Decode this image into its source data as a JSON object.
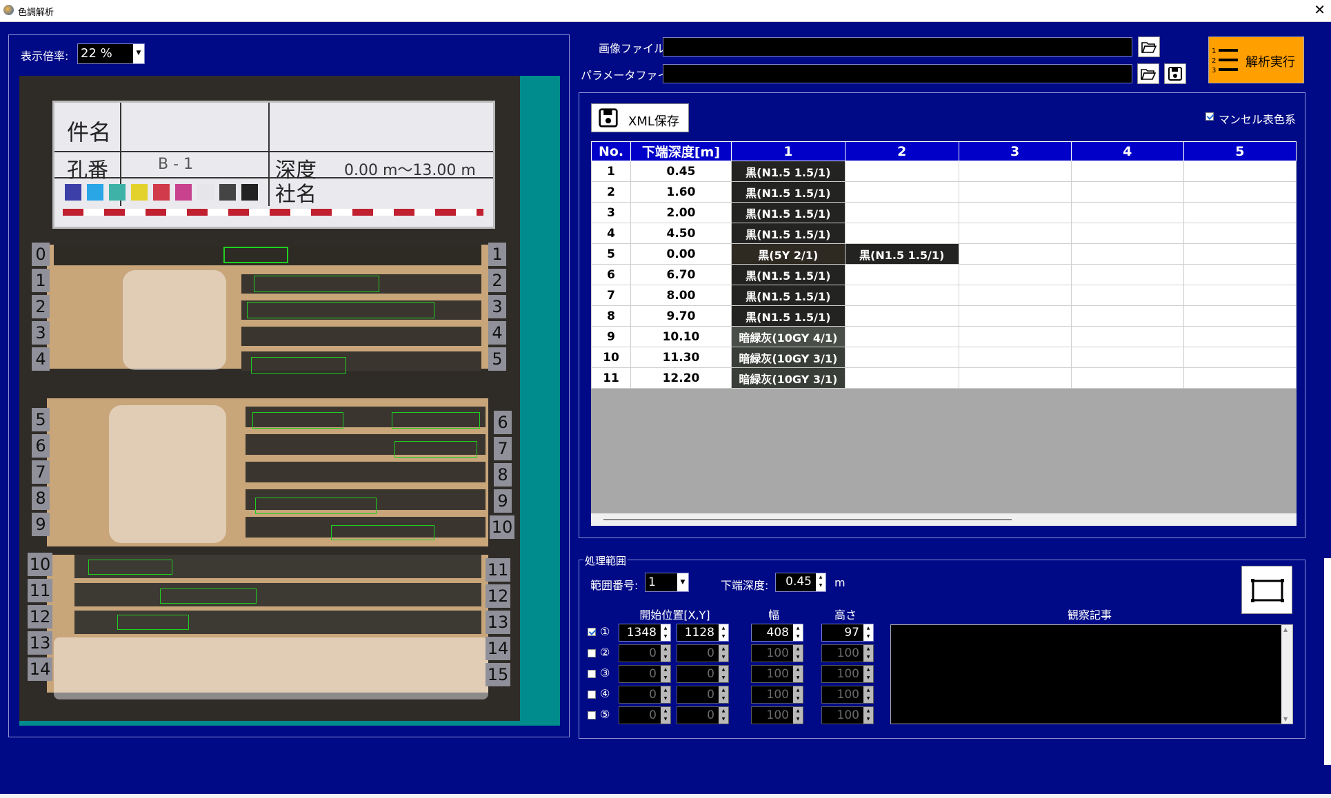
{
  "window": {
    "title": "色調解析",
    "close": "✕"
  },
  "zoom": {
    "label": "表示倍率:",
    "value": "22 %"
  },
  "files": {
    "image_label": "画像ファイル:",
    "param_label": "パラメータファイル:"
  },
  "run": {
    "label": "解析実行",
    "icon": "numbered-list-icon"
  },
  "xml": {
    "label": "XML保存"
  },
  "munsell": {
    "label": "マンセル表色系",
    "checked": true
  },
  "photo": {
    "board_name": "件名",
    "board_hole": "孔番",
    "board_hole_value": "B - 1",
    "board_depth": "深度",
    "board_depth_value": "0.00 m〜13.00 m",
    "board_company": "社名",
    "tags_left": [
      "0",
      "1",
      "2",
      "3",
      "4",
      "5",
      "6",
      "7",
      "8",
      "9",
      "10",
      "11",
      "12",
      "13",
      "14"
    ],
    "tags_right": [
      "1",
      "2",
      "3",
      "4",
      "5",
      "6",
      "7",
      "8",
      "9",
      "10",
      "11",
      "12",
      "13",
      "14",
      "15"
    ]
  },
  "grid": {
    "headers": [
      "No.",
      "下端深度[m]",
      "1",
      "2",
      "3",
      "4",
      "5"
    ],
    "rows": [
      {
        "no": "1",
        "depth": "0.45",
        "c1": "黒(N1.5 1.5/1)",
        "c2": ""
      },
      {
        "no": "2",
        "depth": "1.60",
        "c1": "黒(N1.5 1.5/1)",
        "c2": ""
      },
      {
        "no": "3",
        "depth": "2.00",
        "c1": "黒(N1.5 1.5/1)",
        "c2": ""
      },
      {
        "no": "4",
        "depth": "4.50",
        "c1": "黒(N1.5 1.5/1)",
        "c2": ""
      },
      {
        "no": "5",
        "depth": "0.00",
        "c1": "黒(5Y 2/1)",
        "c2": "黒(N1.5 1.5/1)"
      },
      {
        "no": "6",
        "depth": "6.70",
        "c1": "黒(N1.5 1.5/1)",
        "c2": ""
      },
      {
        "no": "7",
        "depth": "8.00",
        "c1": "黒(N1.5 1.5/1)",
        "c2": ""
      },
      {
        "no": "8",
        "depth": "9.70",
        "c1": "黒(N1.5 1.5/1)",
        "c2": ""
      },
      {
        "no": "9",
        "depth": "10.10",
        "c1": "暗緑灰(10GY 4/1)",
        "c2": ""
      },
      {
        "no": "10",
        "depth": "11.30",
        "c1": "暗緑灰(10GY 3/1)",
        "c2": ""
      },
      {
        "no": "11",
        "depth": "12.20",
        "c1": "暗緑灰(10GY 3/1)",
        "c2": ""
      }
    ]
  },
  "range": {
    "group": "処理範囲",
    "index_label": "範囲番号:",
    "index_value": "1",
    "depth_label": "下端深度:",
    "depth_value": "0.45",
    "depth_unit": "m",
    "col_start": "開始位置[X,Y]",
    "col_width": "幅",
    "col_height": "高さ",
    "col_notes": "観察記事",
    "rows": [
      {
        "mark": "①",
        "x": "1348",
        "y": "1128",
        "w": "408",
        "h": "97",
        "checked": true
      },
      {
        "mark": "②",
        "x": "0",
        "y": "0",
        "w": "100",
        "h": "100",
        "checked": false
      },
      {
        "mark": "③",
        "x": "0",
        "y": "0",
        "w": "100",
        "h": "100",
        "checked": false
      },
      {
        "mark": "④",
        "x": "0",
        "y": "0",
        "w": "100",
        "h": "100",
        "checked": false
      },
      {
        "mark": "⑤",
        "x": "0",
        "y": "0",
        "w": "100",
        "h": "100",
        "checked": false
      }
    ]
  },
  "colors": {
    "background": "#010A86",
    "grid_header": "#0000C8",
    "run_button": "#FF9F00",
    "teal": "#008C8C"
  }
}
